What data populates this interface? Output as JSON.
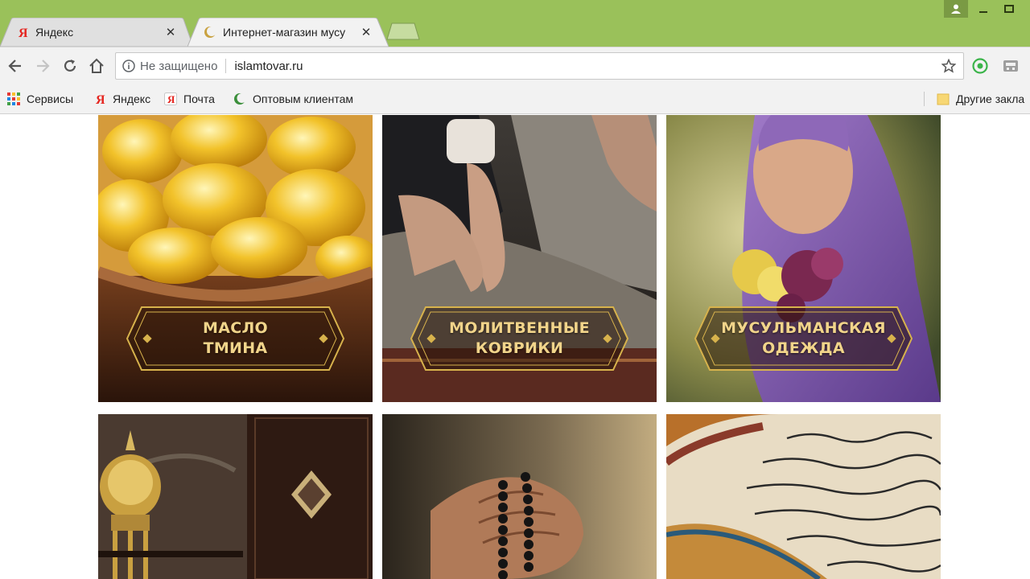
{
  "browser": {
    "tabs": [
      {
        "title": "Яндекс",
        "icon": "yandex-icon",
        "active": false
      },
      {
        "title": "Интернет-магазин мусу",
        "icon": "crescent-icon",
        "active": true
      }
    ],
    "omnibox": {
      "security_label": "Не защищено",
      "url": "islamtovar.ru"
    },
    "bookmarks": [
      {
        "label": "Сервисы",
        "icon": "apps-grid-icon"
      },
      {
        "label": "Яндекс",
        "icon": "yandex-icon"
      },
      {
        "label": "Почта",
        "icon": "yandex-mail-icon"
      },
      {
        "label": "Оптовым клиентам",
        "icon": "crescent-icon"
      }
    ],
    "other_bookmarks": "Другие закла"
  },
  "catalog": {
    "tiles": [
      {
        "line1": "МАСЛО",
        "line2": "ТМИНА"
      },
      {
        "line1": "МОЛИТВЕННЫЕ",
        "line2": "КОВРИКИ"
      },
      {
        "line1": "МУСУЛЬМАНСКАЯ",
        "line2": "ОДЕЖДА"
      }
    ]
  },
  "colors": {
    "frame": "#9ac15a",
    "toolbar": "#f2f2f2",
    "label_gold": "#d7b24c"
  }
}
